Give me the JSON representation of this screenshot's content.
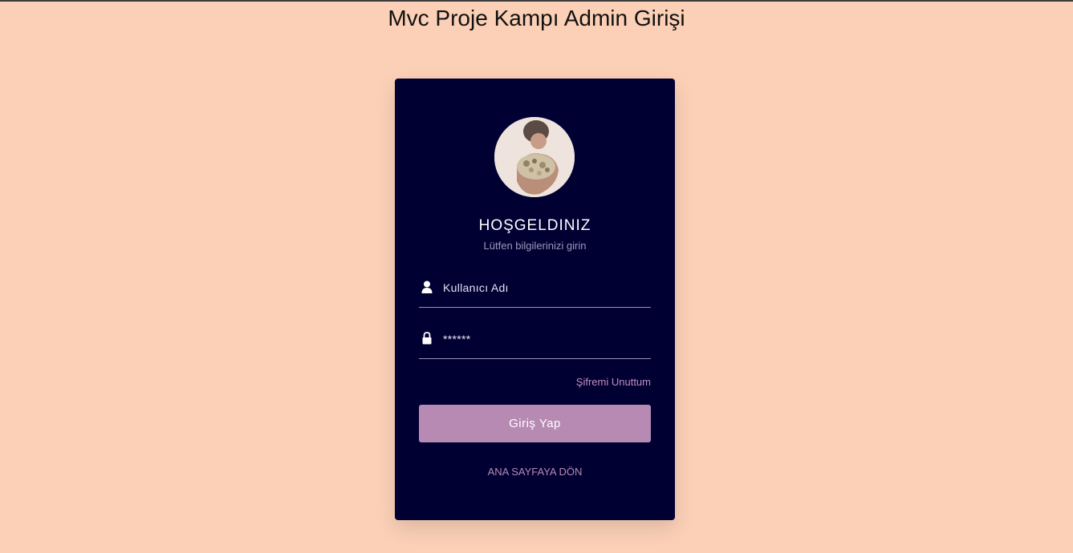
{
  "page": {
    "title": "Mvc Proje Kampı Admin Girişi"
  },
  "login": {
    "avatar_icon": "user-photo-avatar",
    "welcome": "HOŞGELDINIZ",
    "subtitle": "Lütfen bilgilerinizi girin",
    "username": {
      "icon": "user-icon",
      "placeholder": "Kullanıcı Adı",
      "value": ""
    },
    "password": {
      "icon": "lock-icon",
      "placeholder": "******",
      "value": ""
    },
    "forgot_label": "Şifremi Unuttum",
    "submit_label": "Giriş Yap",
    "back_label": "ANA SAYFAYA DÖN"
  },
  "colors": {
    "background": "#fbd0b7",
    "card": "#000033",
    "accent": "#b78ab3",
    "link": "#c18db8"
  }
}
